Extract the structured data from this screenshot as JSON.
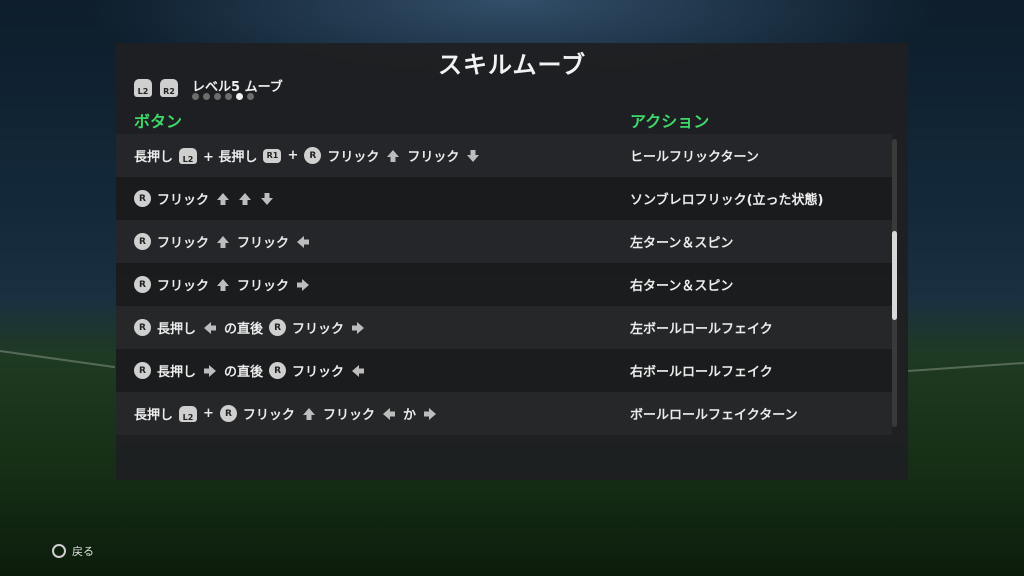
{
  "title": "スキルムーブ",
  "level": {
    "left_trigger": "L2",
    "right_trigger": "R2",
    "label": "レベル5 ムーブ",
    "dots_total": 6,
    "dots_active_index": 4
  },
  "headers": {
    "button": "ボタン",
    "action": "アクション"
  },
  "rows": [
    {
      "combo": [
        {
          "t": "text",
          "v": "長押し"
        },
        {
          "t": "trig",
          "v": "L2"
        },
        {
          "t": "text",
          "v": "+ 長押し"
        },
        {
          "t": "r1",
          "v": "R1"
        },
        {
          "t": "text",
          "v": "+"
        },
        {
          "t": "r",
          "v": "R"
        },
        {
          "t": "text",
          "v": "フリック"
        },
        {
          "t": "arrow",
          "v": "up"
        },
        {
          "t": "text",
          "v": "フリック"
        },
        {
          "t": "arrow",
          "v": "down"
        }
      ],
      "action": "ヒールフリックターン"
    },
    {
      "combo": [
        {
          "t": "r",
          "v": "R"
        },
        {
          "t": "text",
          "v": "フリック"
        },
        {
          "t": "arrow",
          "v": "up"
        },
        {
          "t": "arrow",
          "v": "up"
        },
        {
          "t": "arrow",
          "v": "down"
        }
      ],
      "action": "ソンブレロフリック(立った状態)"
    },
    {
      "combo": [
        {
          "t": "r",
          "v": "R"
        },
        {
          "t": "text",
          "v": "フリック"
        },
        {
          "t": "arrow",
          "v": "up"
        },
        {
          "t": "text",
          "v": "フリック"
        },
        {
          "t": "arrow",
          "v": "left"
        }
      ],
      "action": "左ターン＆スピン"
    },
    {
      "combo": [
        {
          "t": "r",
          "v": "R"
        },
        {
          "t": "text",
          "v": "フリック"
        },
        {
          "t": "arrow",
          "v": "up"
        },
        {
          "t": "text",
          "v": "フリック"
        },
        {
          "t": "arrow",
          "v": "right"
        }
      ],
      "action": "右ターン＆スピン"
    },
    {
      "combo": [
        {
          "t": "r",
          "v": "R"
        },
        {
          "t": "text",
          "v": "長押し"
        },
        {
          "t": "arrow",
          "v": "left"
        },
        {
          "t": "text",
          "v": "の直後"
        },
        {
          "t": "r",
          "v": "R"
        },
        {
          "t": "text",
          "v": "フリック"
        },
        {
          "t": "arrow",
          "v": "right"
        }
      ],
      "action": "左ボールロールフェイク"
    },
    {
      "combo": [
        {
          "t": "r",
          "v": "R"
        },
        {
          "t": "text",
          "v": "長押し"
        },
        {
          "t": "arrow",
          "v": "right"
        },
        {
          "t": "text",
          "v": "の直後"
        },
        {
          "t": "r",
          "v": "R"
        },
        {
          "t": "text",
          "v": "フリック"
        },
        {
          "t": "arrow",
          "v": "left"
        }
      ],
      "action": "右ボールロールフェイク"
    },
    {
      "combo": [
        {
          "t": "text",
          "v": "長押し"
        },
        {
          "t": "trig",
          "v": "L2"
        },
        {
          "t": "text",
          "v": "+"
        },
        {
          "t": "r",
          "v": "R"
        },
        {
          "t": "text",
          "v": "フリック"
        },
        {
          "t": "arrow",
          "v": "up"
        },
        {
          "t": "text",
          "v": "フリック"
        },
        {
          "t": "arrow",
          "v": "left"
        },
        {
          "t": "text",
          "v": "か"
        },
        {
          "t": "arrow",
          "v": "right"
        }
      ],
      "action": "ボールロールフェイクターン"
    }
  ],
  "scroll": {
    "position_fraction": 0.32,
    "visible_fraction": 0.31
  },
  "footer": {
    "back_label": "戻る",
    "back_icon": "circle-button-icon"
  },
  "colors": {
    "accent_green": "#3fd86a",
    "panel": "#1e1f21"
  }
}
